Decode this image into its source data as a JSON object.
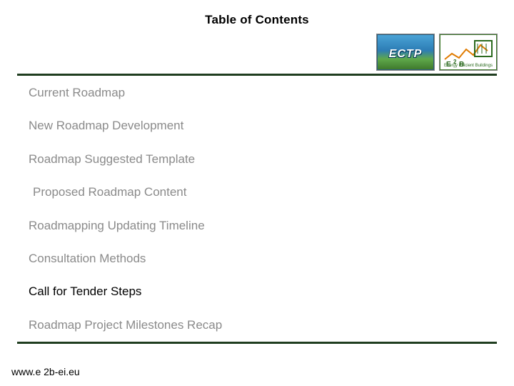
{
  "title": "Table of Contents",
  "logos": {
    "ectp": {
      "text": "ECTP"
    },
    "e2b": {
      "main": "E 2 B",
      "caption": "Energy Efficient Buildings"
    }
  },
  "toc": [
    {
      "label": "Current Roadmap",
      "active": false
    },
    {
      "label": "New Roadmap Development",
      "active": false
    },
    {
      "label": "Roadmap Suggested Template",
      "active": false
    },
    {
      "label": "Proposed Roadmap Content",
      "active": false
    },
    {
      "label": "Roadmapping Updating Timeline",
      "active": false
    },
    {
      "label": "Consultation Methods",
      "active": false
    },
    {
      "label": "Call for Tender Steps",
      "active": true
    },
    {
      "label": "Roadmap Project Milestones Recap",
      "active": false
    }
  ],
  "footer": "www.e 2b-ei.eu"
}
